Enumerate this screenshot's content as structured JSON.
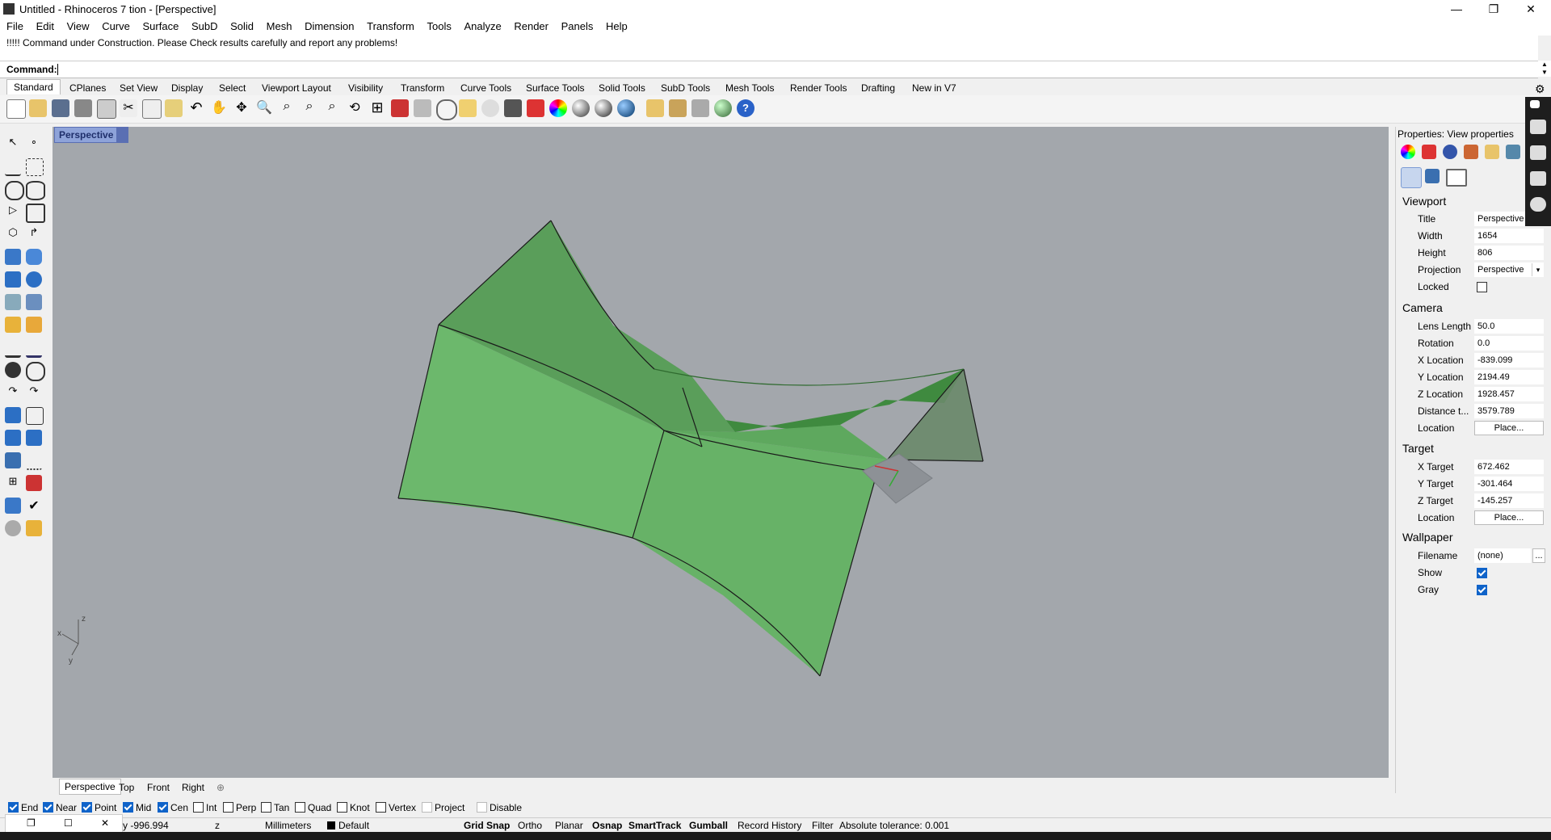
{
  "window": {
    "title": "Untitled - Rhinoceros 7 tion - [Perspective]",
    "controls": {
      "minimize": "—",
      "maximize": "❐",
      "close": "✕"
    }
  },
  "menu": [
    "File",
    "Edit",
    "View",
    "Curve",
    "Surface",
    "SubD",
    "Solid",
    "Mesh",
    "Dimension",
    "Transform",
    "Tools",
    "Analyze",
    "Render",
    "Panels",
    "Help"
  ],
  "command": {
    "history": "!!!!! Command under Construction.  Please Check results carefully and report any problems!",
    "prompt": "Command:"
  },
  "toolbar_tabs": [
    "Standard",
    "CPlanes",
    "Set View",
    "Display",
    "Select",
    "Viewport Layout",
    "Visibility",
    "Transform",
    "Curve Tools",
    "Surface Tools",
    "Solid Tools",
    "SubD Tools",
    "Mesh Tools",
    "Render Tools",
    "Drafting",
    "New in V7"
  ],
  "viewport": {
    "name": "Perspective",
    "colors": {
      "background": "#a3a7ac",
      "surface_light": "#6cb86c",
      "surface_mid": "#5fa05f",
      "surface_dark": "#3a7d3a"
    },
    "axes": {
      "x": "x",
      "y": "y",
      "z": "z"
    }
  },
  "viewport_tabs": [
    "Perspective",
    "Top",
    "Front",
    "Right",
    "⊕"
  ],
  "osnap": [
    {
      "label": "End",
      "on": true
    },
    {
      "label": "Near",
      "on": true
    },
    {
      "label": "Point",
      "on": true
    },
    {
      "label": "Mid",
      "on": true
    },
    {
      "label": "Cen",
      "on": true
    },
    {
      "label": "Int",
      "on": false
    },
    {
      "label": "Perp",
      "on": false
    },
    {
      "label": "Tan",
      "on": false
    },
    {
      "label": "Quad",
      "on": false
    },
    {
      "label": "Knot",
      "on": false
    },
    {
      "label": "Vertex",
      "on": false
    },
    {
      "label": "Project",
      "on": false
    },
    {
      "label": "Disable",
      "on": false
    }
  ],
  "status": {
    "coord_y": "y -996.994",
    "coord_z": "z",
    "units": "Millimeters",
    "layer": "Default",
    "toggles": [
      "Grid Snap",
      "Ortho",
      "Planar",
      "Osnap",
      "SmartTrack",
      "Gumball",
      "Record History",
      "Filter"
    ],
    "tolerance": "Absolute tolerance: 0.001"
  },
  "properties": {
    "header": "Properties: View properties",
    "viewport_section": "Viewport",
    "camera_section": "Camera",
    "target_section": "Target",
    "wallpaper_section": "Wallpaper",
    "title_label": "Title",
    "title_value": "Perspective",
    "width_label": "Width",
    "width_value": "1654",
    "height_label": "Height",
    "height_value": "806",
    "projection_label": "Projection",
    "projection_value": "Perspective",
    "locked_label": "Locked",
    "lens_label": "Lens Length",
    "lens_value": "50.0",
    "rotation_label": "Rotation",
    "rotation_value": "0.0",
    "xloc_label": "X Location",
    "xloc_value": "-839.099",
    "yloc_label": "Y Location",
    "yloc_value": "2194.49",
    "zloc_label": "Z Location",
    "zloc_value": "1928.457",
    "dist_label": "Distance t...",
    "dist_value": "3579.789",
    "cam_location_label": "Location",
    "place_label": "Place...",
    "xtarget_label": "X Target",
    "xtarget_value": "672.462",
    "ytarget_label": "Y Target",
    "ytarget_value": "-301.464",
    "ztarget_label": "Z Target",
    "ztarget_value": "-145.257",
    "target_location_label": "Location",
    "filename_label": "Filename",
    "filename_value": "(none)",
    "filename_btn": "...",
    "show_label": "Show",
    "gray_label": "Gray"
  }
}
